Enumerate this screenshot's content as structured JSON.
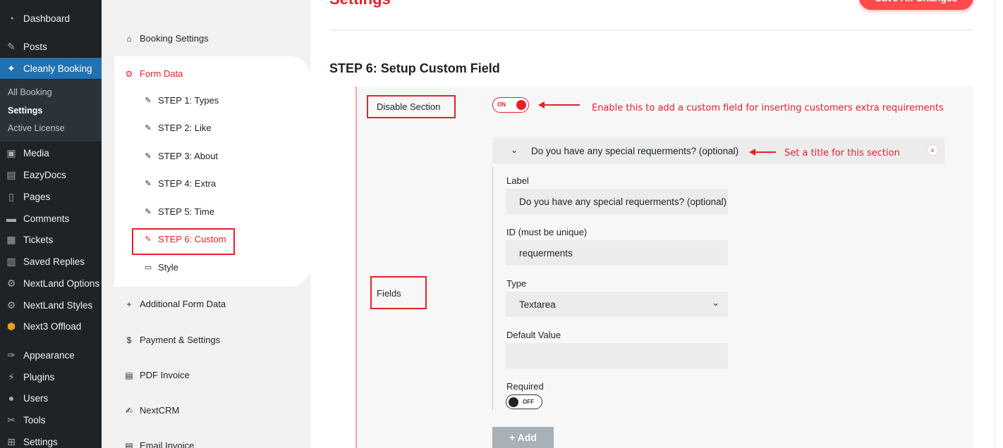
{
  "wp_menu": {
    "items": [
      {
        "label": "Dashboard",
        "icon": "gauge-icon"
      },
      {
        "label": "Posts",
        "icon": "pin-icon"
      },
      {
        "label": "Cleanly Booking",
        "icon": "cleanly-icon"
      },
      {
        "label": "Media",
        "icon": "media-icon"
      },
      {
        "label": "EazyDocs",
        "icon": "doc-icon"
      },
      {
        "label": "Pages",
        "icon": "pages-icon"
      },
      {
        "label": "Comments",
        "icon": "comment-icon"
      },
      {
        "label": "Tickets",
        "icon": "ticket-icon"
      },
      {
        "label": "Saved Replies",
        "icon": "book-icon"
      },
      {
        "label": "NextLand Options",
        "icon": "gear-icon"
      },
      {
        "label": "NextLand Styles",
        "icon": "gear-icon"
      },
      {
        "label": "Next3 Offload",
        "icon": "hexagon-icon"
      },
      {
        "label": "Appearance",
        "icon": "brush-icon"
      },
      {
        "label": "Plugins",
        "icon": "plug-icon"
      },
      {
        "label": "Users",
        "icon": "user-icon"
      },
      {
        "label": "Tools",
        "icon": "wrench-icon"
      },
      {
        "label": "Settings",
        "icon": "settings-icon"
      }
    ],
    "submenu": [
      "All Booking",
      "Settings",
      "Active License"
    ]
  },
  "tabs": {
    "booking_settings": "Booking Settings",
    "form_data": "Form Data",
    "steps": [
      "STEP 1: Types",
      "STEP 2: Like",
      "STEP 3: About",
      "STEP 4: Extra",
      "STEP 5: Time",
      "STEP 6: Custom"
    ],
    "style": "Style",
    "additional_form_data": "Additional Form Data",
    "payment_settings": "Payment & Settings",
    "pdf_invoice": "PDF Invoice",
    "nextcrm": "NextCRM",
    "email_invoice": "Email Invoice"
  },
  "header": {
    "title": "Settings",
    "save_label": "Save All Changes"
  },
  "step": {
    "title": "STEP 6: Setup Custom Field",
    "disable_section_label": "Disable Section",
    "toggle_on_text": "ON",
    "annotation_toggle": "Enable this to add a custom field for inserting customers extra requirements",
    "fields_label": "Fields",
    "section_title": "Do you have any special requerments? (optional)",
    "annotation_title": "Set a title for this section",
    "close_label": "x",
    "label_caption": "Label",
    "label_value": "Do you have any special requerments? (optional)",
    "id_caption": "ID (must be unique)",
    "id_value": "requerments",
    "type_caption": "Type",
    "type_value": "Textarea",
    "default_caption": "Default Value",
    "default_value": "",
    "required_caption": "Required",
    "toggle_off_text": "OFF",
    "add_label": "+ Add"
  },
  "colors": {
    "accent": "#e8202a",
    "wp_sidebar": "#1d2327",
    "wp_active": "#2271b1"
  }
}
